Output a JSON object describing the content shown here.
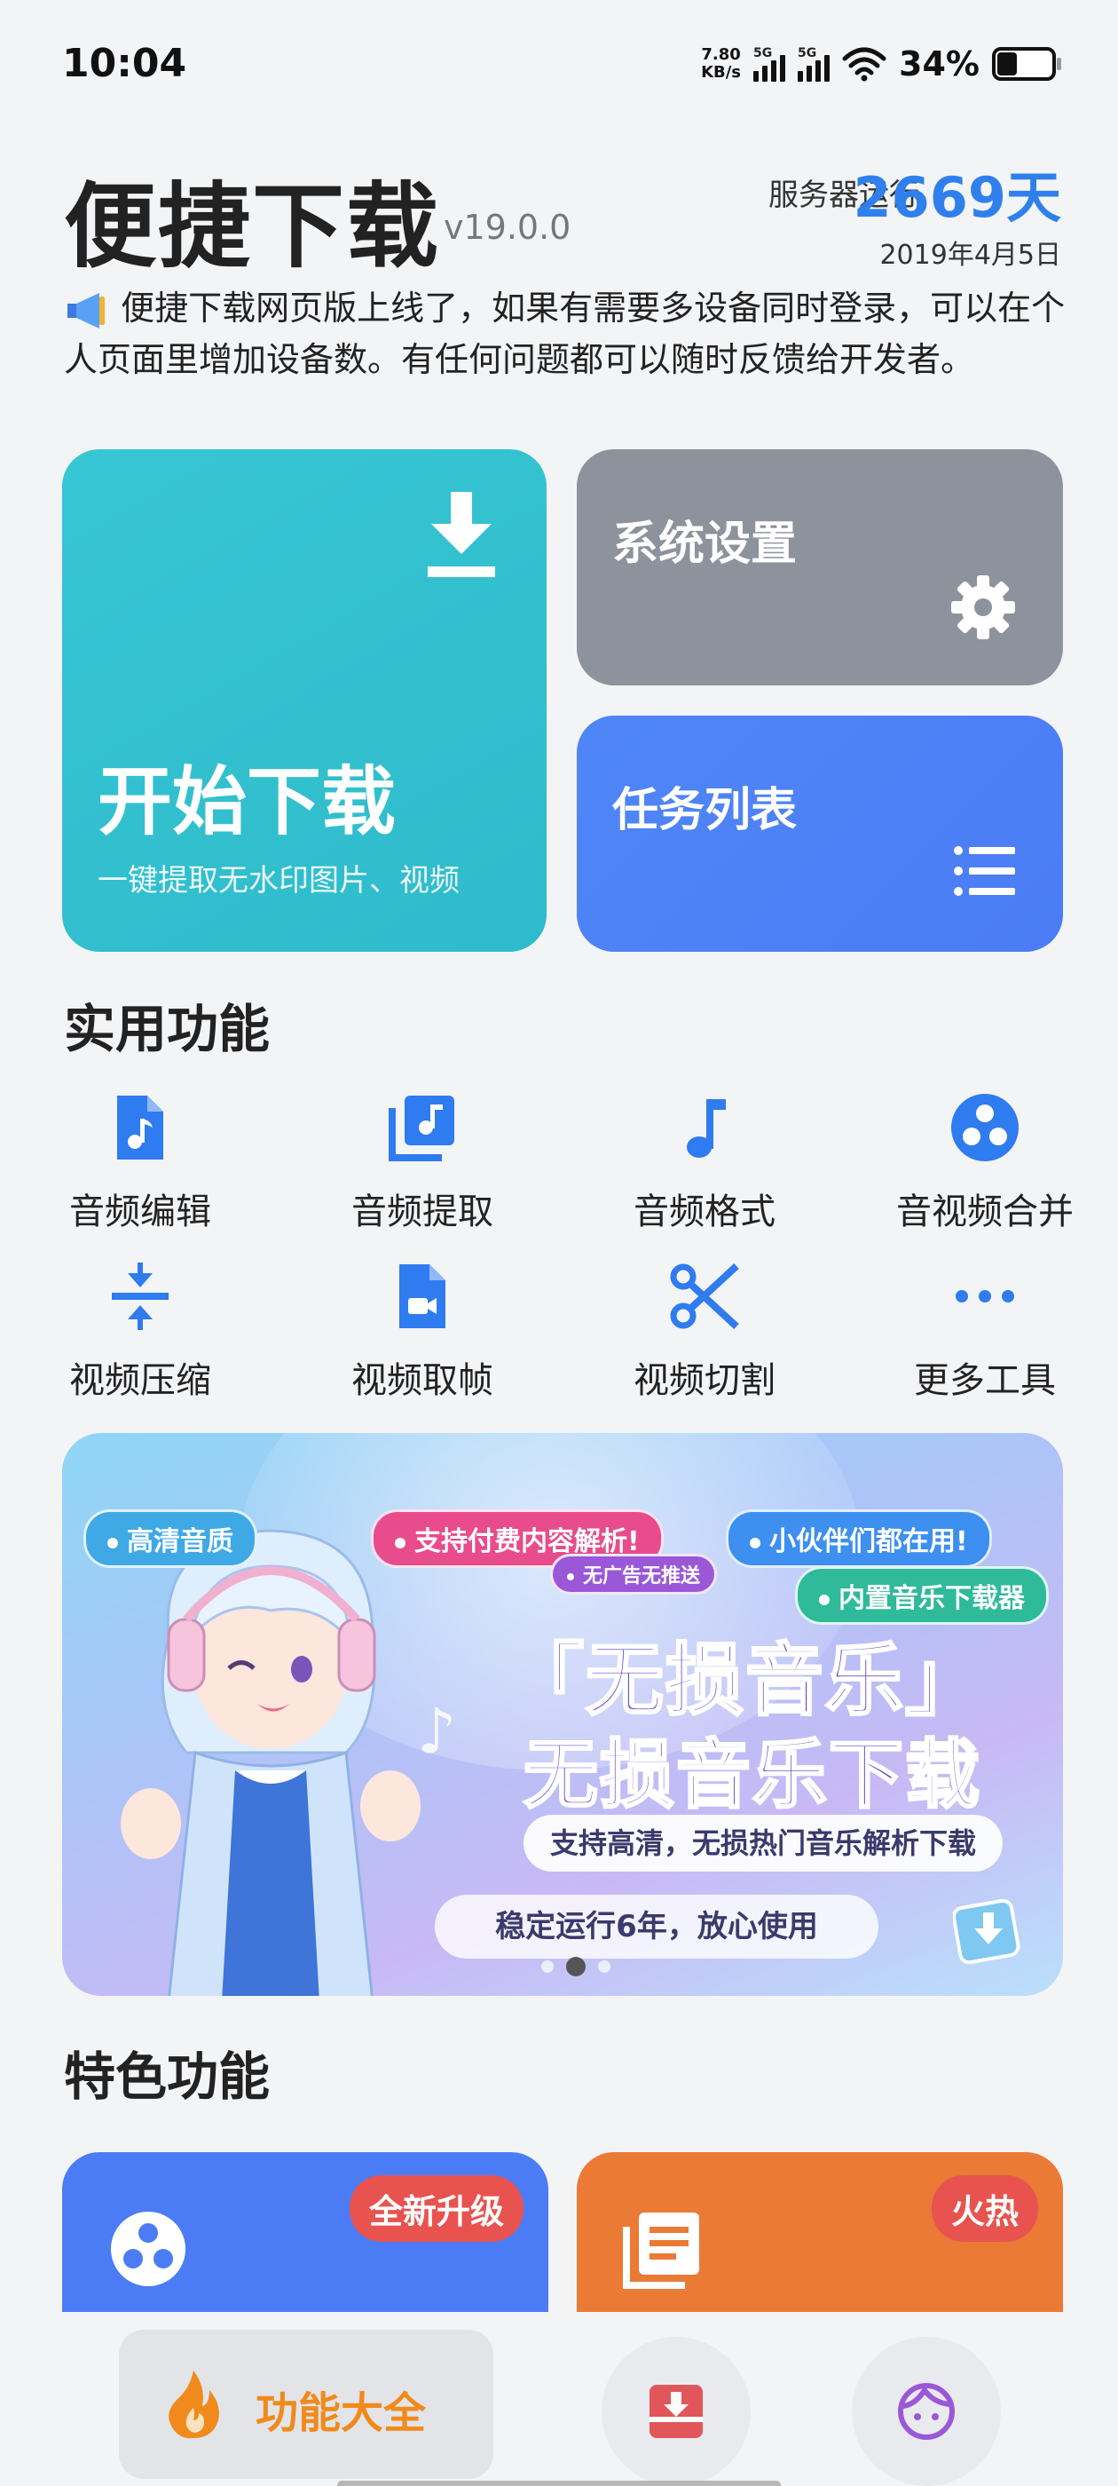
{
  "status_bar": {
    "time": "10:04",
    "net_speed_value": "7.80",
    "net_speed_unit": "KB/s",
    "sim1": "5G",
    "sim2": "5G",
    "battery": "34%"
  },
  "header": {
    "title": "便捷下载",
    "version": "v19.0.0",
    "server_label": "服务器运行",
    "server_days": "2669天",
    "server_date": "2019年4月5日"
  },
  "notice": {
    "icon": "megaphone-icon",
    "text": "便捷下载网页版上线了，如果有需要多设备同时登录，可以在个人页面里增加设备数。有任何问题都可以随时反馈给开发者。"
  },
  "cards": {
    "download": {
      "title": "开始下载",
      "subtitle": "一键提取无水印图片、视频",
      "color": "#37c6d4"
    },
    "settings": {
      "title": "系统设置",
      "color": "#8e929c"
    },
    "tasks": {
      "title": "任务列表",
      "color": "#4b7cf5"
    }
  },
  "tools_section": {
    "title": "实用功能",
    "items": [
      {
        "label": "音频编辑",
        "icon": "audio-file-icon"
      },
      {
        "label": "音频提取",
        "icon": "music-library-icon"
      },
      {
        "label": "音频格式",
        "icon": "music-note-icon"
      },
      {
        "label": "音视频合并",
        "icon": "merge-circle-icon"
      },
      {
        "label": "视频压缩",
        "icon": "compress-icon"
      },
      {
        "label": "视频取帧",
        "icon": "video-file-icon"
      },
      {
        "label": "视频切割",
        "icon": "scissors-icon"
      },
      {
        "label": "更多工具",
        "icon": "more-dots-icon"
      }
    ],
    "accent": "#2f7bf0"
  },
  "banner": {
    "tags": [
      "高清音质",
      "支持付费内容解析!",
      "无广告无推送",
      "小伙伴们都在用!",
      "内置音乐下载器"
    ],
    "title_line1": "「无损音乐」",
    "title_line2": "无损音乐下载",
    "subtitle": "支持高清，无损热门音乐解析下载",
    "footer": "稳定运行6年，放心使用"
  },
  "features_section": {
    "title": "特色功能",
    "cards": [
      {
        "badge": "全新升级",
        "icon": "merge-circle-icon",
        "color": "#4b7cf5"
      },
      {
        "badge": "火热",
        "icon": "document-list-icon",
        "color": "#ea7a35"
      }
    ]
  },
  "bottom_nav": {
    "active_label": "功能大全",
    "items": [
      "flame-icon",
      "download-box-icon",
      "face-icon"
    ]
  }
}
